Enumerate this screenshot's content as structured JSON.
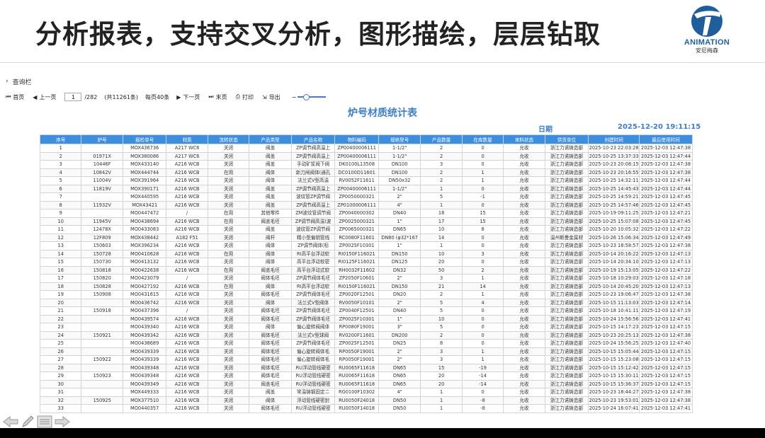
{
  "slide": {
    "title": "分析报表，支持交叉分析，图形描绘，层层钻取",
    "logo_brand": "ANIMATION",
    "logo_sub": "安尼梅森",
    "brand_color": "#1f5e9a"
  },
  "query_bar": {
    "label": "查询栏"
  },
  "toolbar": {
    "first": "首页",
    "prev": "上一页",
    "page_value": "1",
    "page_total": "/282",
    "records": "(共11261条)",
    "per_page": "每页40条",
    "next": "下一页",
    "last": "末页",
    "print": "打印",
    "export": "导出"
  },
  "report": {
    "title": "炉号材质统计表",
    "date_label": "日期",
    "date_value": "2025-12-20 19:11:15",
    "header_color": "#3d8ede",
    "columns": [
      "序号",
      "炉号",
      "报检单号",
      "材质",
      "流转状态",
      "产品类型",
      "产品名称",
      "物料编码",
      "规格型号",
      "产品数量",
      "在库数量",
      "来料状态",
      "供货单位",
      "创建时间",
      "最后使用时间"
    ],
    "rows": [
      [
        "1",
        "",
        "MOX436736",
        "A217 WC6",
        "关闭",
        "阀盖",
        "ZP调节阀高温上",
        "ZP00400006111",
        "1-1/2\"",
        "2",
        "0",
        "允收",
        "浙江力诺铸造部",
        "2025-10-23 22:03:28",
        "2025-12-03 12:47:38"
      ],
      [
        "2",
        "01971X",
        "MOX380086",
        "A217 WC6",
        "关闭",
        "阀盖",
        "ZP调节阀高温上",
        "ZP00400006111",
        "1-1/2\"",
        "2",
        "0",
        "允收",
        "浙江力诺铸造部",
        "2025-10-25 13:37:33",
        "2025-12-03 12:47:44"
      ],
      [
        "3",
        "10446F",
        "MOX433140",
        "A216 WCB",
        "关闭",
        "阀盖",
        "手动矿浆阀下阀",
        "DK0100L13508",
        "DN100",
        "3",
        "0",
        "允收",
        "浙江力诺铸造部",
        "2025-10-23 20:08:15",
        "2025-12-03 12:47:38"
      ],
      [
        "4",
        "10842V",
        "MOX444744",
        "A216 WCB",
        "在用",
        "阀体",
        "新刀闸阀体(通孔",
        "DC0100D11601",
        "DN100",
        "2",
        "1",
        "允收",
        "浙江力诺铸造部",
        "2025-10-23 20:16:55",
        "2025-12-03 12:47:38"
      ],
      [
        "5",
        "11004V",
        "MOX391964",
        "A216 WCB",
        "关闭",
        "阀体",
        "法兰式V型高温",
        "RV0052F11611",
        "DN50x32",
        "2",
        "1",
        "允收",
        "浙江力诺铸造部",
        "2025-10-25 14:32:11",
        "2025-12-03 12:47:44"
      ],
      [
        "6",
        "11819V",
        "MOX390171",
        "A216 WCB",
        "关闭",
        "阀盖",
        "ZP调节阀高温上",
        "ZP00400006111",
        "1-1/2\"",
        "1",
        "0",
        "允收",
        "浙江力诺铸造部",
        "2025-10-25 14:45:43",
        "2025-12-03 12:47:44"
      ],
      [
        "7",
        "",
        "MOX440595",
        "A216 WCB",
        "关闭",
        "阀盖",
        "波纹管ZP调节阀",
        "ZP0050000321",
        "2\"",
        "5",
        "-1",
        "允收",
        "浙江力诺铸造部",
        "2025-10-25 14:59:21",
        "2025-12-03 12:47:45"
      ],
      [
        "8",
        "11932V",
        "MOX43421",
        "A216 WCB",
        "关闭",
        "阀盖",
        "ZP调节阀高温上",
        "ZP01000006111",
        "4\"",
        "1",
        "0",
        "允收",
        "浙江力诺铸造部",
        "2025-10-25 14:57:46",
        "2025-12-03 12:47:45"
      ],
      [
        "9",
        "",
        "MO0447472",
        "/",
        "在用",
        "其他零件",
        "ZM波纹管调节阀",
        "ZP0040000302",
        "DN40",
        "18",
        "15",
        "允收",
        "浙江力诺铸造部",
        "2025-10-19 09:11:25",
        "2025-12-03 12:47:21"
      ],
      [
        "10",
        "11945V",
        "MO0438694",
        "A216 WCB",
        "在用",
        "阀盖毛坯",
        "ZP调节阀高温(波",
        "ZP0025000321",
        "1\"",
        "17",
        "15",
        "允收",
        "浙江力诺铸造部",
        "2025-10-25 15:07:08",
        "2025-12-03 12:47:45"
      ],
      [
        "11",
        "12478X",
        "MO0433083",
        "A216 WCB",
        "关闭",
        "阀盖",
        "波纹管ZP调节阀",
        "ZP0065000321",
        "DN65",
        "10",
        "8",
        "允收",
        "浙江力诺铸造部",
        "2025-10-20 10:05:32",
        "2025-12-03 12:47:22"
      ],
      [
        "12",
        "12F809",
        "MOX438442",
        "A182 F51",
        "关闭",
        "阀杆",
        "精小型偏销管线",
        "RC0080F11601",
        "DN80 (φ32*167",
        "14",
        "0",
        "允收",
        "温州斯曼金属材",
        "2025-10-26 15:06:34",
        "2025-12-03 12:47:49"
      ],
      [
        "13",
        "150603",
        "MOX396234",
        "A216 WCB",
        "关闭",
        "阀体",
        "ZP调节阀体(标",
        "ZP0025F10301",
        "1\"",
        "1",
        "0",
        "允收",
        "浙江力诺铸造部",
        "2025-10-23 18:58:57",
        "2025-12-03 12:47:38"
      ],
      [
        "14",
        "150728",
        "MO0410628",
        "A216 WCB",
        "在用",
        "阀体",
        "RI高平台浮动软",
        "RI0150F116021",
        "DN150",
        "10",
        "3",
        "允收",
        "浙江力诺铸造部",
        "2025-10-14 20:16:22",
        "2025-12-03 12:47:13"
      ],
      [
        "15",
        "150730",
        "MO0413132",
        "A216 WCB",
        "关闭",
        "阀体",
        "高平台浮动软密",
        "RI0125F116021",
        "DN125",
        "20",
        "0",
        "允收",
        "浙江力诺铸造部",
        "2025-10-14 20:34:10",
        "2025-12-03 12:47:13"
      ],
      [
        "16",
        "150818",
        "MO0422638",
        "A216 WCB",
        "在用",
        "阀盖毛坯",
        "高平台浮动式软",
        "RH0032F11602",
        "DN32",
        "50",
        "2",
        "允收",
        "浙江力诺铸造部",
        "2025-10-19 15:13:05",
        "2025-12-03 12:47:22"
      ],
      [
        "17",
        "150820",
        "MO0423079",
        "/",
        "关闭",
        "阀体毛坯",
        "ZP调节阀体毛坯",
        "ZP2050F10601",
        "2\"",
        "3",
        "1",
        "允收",
        "浙江力诺铸造部",
        "2025-10-18 10:29:03",
        "2025-12-03 12:47:18"
      ],
      [
        "18",
        "150828",
        "MO0427192",
        "A216 WCB",
        "在用",
        "阀体",
        "RI高平台浮动软",
        "RI0150F116021",
        "DN150",
        "21",
        "14",
        "允收",
        "浙江力诺铸造部",
        "2025-10-14 20:45:20",
        "2025-12-03 12:47:13"
      ],
      [
        "19",
        "150908",
        "MO0431615",
        "A216 WCB",
        "关闭",
        "阀体毛坯",
        "ZP调节阀体毛坯",
        "ZP0020F12501",
        "DN20",
        "2",
        "1",
        "允收",
        "浙江力诺铸造部",
        "2025-10-23 19:06:47",
        "2025-12-03 12:47:38"
      ],
      [
        "20",
        "",
        "MO0436742",
        "A216 WCB",
        "关闭",
        "阀体",
        "法兰式V型阀体",
        "RV0050F10101",
        "2\"",
        "5",
        "4",
        "允收",
        "浙江力诺铸造部",
        "2025-10-15 11:13:03",
        "2025-12-03 12:47:14"
      ],
      [
        "21",
        "150918",
        "MO0437396",
        "/",
        "关闭",
        "阀体毛坯",
        "ZP调节阀体毛坯",
        "ZP0040F12501",
        "DN40",
        "5",
        "0",
        "允收",
        "浙江力诺铸造部",
        "2025-10-18 10:41:11",
        "2025-12-03 12:47:19"
      ],
      [
        "22",
        "",
        "MO0439574",
        "A216 WCB",
        "关闭",
        "阀体毛坯",
        "ZP调节阀体毛坯",
        "ZP0025F10301",
        "1\"",
        "10",
        "0",
        "允收",
        "浙江力诺铸造部",
        "2025-10-24 15:56:56",
        "2025-12-03 12:47:41"
      ],
      [
        "23",
        "",
        "MO0439340",
        "A216 WCB",
        "关闭",
        "阀体",
        "偏心旋转阀阀体",
        "RP0080F19001",
        "3\"",
        "5",
        "0",
        "允收",
        "浙江力诺铸造部",
        "2025-10-15 14:17:23",
        "2025-12-03 12:47:15"
      ],
      [
        "24",
        "150921",
        "MO0439342",
        "A216 WCB",
        "关闭",
        "阀体毛坯",
        "法兰式V型球阀",
        "RV0200F11601",
        "DN200",
        "2",
        "0",
        "允收",
        "浙江力诺铸造部",
        "2025-10-23 20:25:13",
        "2025-12-03 12:47:38"
      ],
      [
        "25",
        "",
        "MO0438689",
        "A216 WCB",
        "关闭",
        "阀体毛坯",
        "ZP调节阀体毛坯",
        "ZP0025F12501",
        "DN25",
        "8",
        "0",
        "允收",
        "浙江力诺铸造部",
        "2025-10-24 15:56:25",
        "2025-12-03 12:47:40"
      ],
      [
        "26",
        "",
        "MO0439339",
        "A216 WCB",
        "关闭",
        "阀体毛坯",
        "偏心旋转阀体毛",
        "RP0050F19001",
        "2\"",
        "3",
        "1",
        "允收",
        "浙江力诺铸造部",
        "2025-10-15 15:05:44",
        "2025-12-03 12:47:15"
      ],
      [
        "27",
        "150922",
        "MO0439339",
        "A216 WCB",
        "关闭",
        "阀体毛坯",
        "偏心旋转阀体毛",
        "RP0050F19001",
        "2\"",
        "3",
        "1",
        "允收",
        "浙江力诺铸造部",
        "2025-10-15 15:23:08",
        "2025-12-03 12:47:15"
      ],
      [
        "28",
        "",
        "MO0439348",
        "A216 WCB",
        "关闭",
        "阀体毛坯",
        "RU浮动管线硬密",
        "RU0065F11618",
        "DN65",
        "15",
        "-19",
        "允收",
        "浙江力诺铸造部",
        "2025-10-15 15:12:42",
        "2025-12-03 12:47:15"
      ],
      [
        "29",
        "150923",
        "MO0439348",
        "A216 WCB",
        "关闭",
        "阀体毛坯",
        "RU浮动管线硬密",
        "RU0065F11618",
        "DN65",
        "20",
        "-14",
        "允收",
        "浙江力诺铸造部",
        "2025-10-15 15:30:11",
        "2025-12-03 12:47:15"
      ],
      [
        "30",
        "",
        "MO0439349",
        "A216 WCB",
        "关闭",
        "阀盖毛坯",
        "RU浮动管线硬密",
        "RU0065F11618",
        "DN65",
        "20",
        "-14",
        "允收",
        "浙江力诺铸造部",
        "2025-10-15 15:36:37",
        "2025-12-03 12:47:15"
      ],
      [
        "31",
        "",
        "MOX449333",
        "A216 WCB",
        "关闭",
        "阀盖",
        "常温铸钢固定二",
        "RG0100F10302",
        "4\"",
        "1",
        "0",
        "允收",
        "浙江力诺铸造部",
        "2025-10-23 18:44:27",
        "2025-12-03 12:47:38"
      ],
      [
        "32",
        "150925",
        "MOX377510",
        "A216 WCB",
        "关闭",
        "阀体",
        "浮动管线硬密封",
        "RU0050F24018",
        "DN50",
        "1",
        "-8",
        "允收",
        "浙江力诺铸造部",
        "2025-10-23 19:53:01",
        "2025-12-03 12:47:38"
      ],
      [
        "33",
        "",
        "MO0440357",
        "A216 WCB",
        "关闭",
        "阀体毛坯",
        "RU浮动管线硬密",
        "RU0050F14018",
        "DN50",
        "1",
        "-8",
        "允收",
        "浙江力诺铸造部",
        "2025-10-24 16:07:41",
        "2025-12-03 12:47:41"
      ]
    ]
  }
}
